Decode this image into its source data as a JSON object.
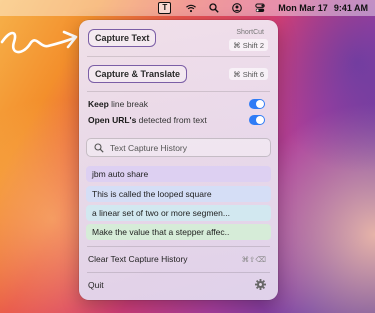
{
  "menubar": {
    "app_icon_letter": "T",
    "icons": [
      "wifi-icon",
      "search-icon",
      "user-icon",
      "control-center-icon"
    ],
    "date": "Mon Mar 17",
    "time": "9:41 AM"
  },
  "menu": {
    "capture_text_label": "Capture Text",
    "shortcut_header": "ShortCut",
    "capture_text_shortcut": "⌘ Shift 2",
    "capture_translate_label": "Capture & Translate",
    "capture_translate_shortcut": "⌘ Shift 6",
    "keep_line_break_bold": "Keep",
    "keep_line_break_rest": " line break",
    "keep_line_break_on": true,
    "open_urls_bold": "Open URL's",
    "open_urls_rest": " detected from text",
    "open_urls_on": true,
    "search_placeholder": "Text Capture History",
    "history": [
      {
        "text": "jbm auto share",
        "color": "#ddd0f2"
      },
      {
        "text": "This is called the looped square",
        "color": "#d5def6"
      },
      {
        "text": "a linear set of two or more segmen...",
        "color": "#d2e8f0"
      },
      {
        "text": "Make the value that a stepper affec..",
        "color": "#d6ecd8"
      }
    ],
    "clear_history_label": "Clear Text Capture History",
    "clear_history_shortcut": "⌘⇧⌫",
    "quit_label": "Quit"
  },
  "colors": {
    "accent_border": "#7b5ea6",
    "toggle_on": "#2f7cf6"
  }
}
